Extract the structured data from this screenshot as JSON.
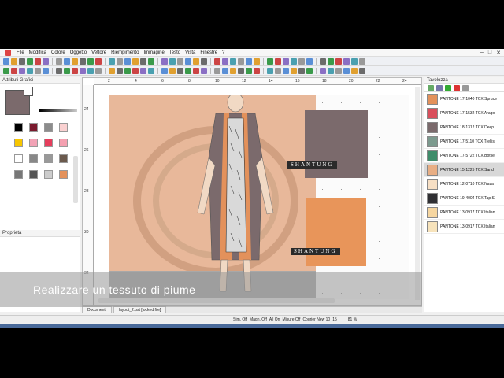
{
  "menu": [
    "File",
    "Modifica",
    "Colore",
    "Oggetto",
    "Vettore",
    "Riempimento",
    "Immagine",
    "Testo",
    "Vista",
    "Finestre",
    "?"
  ],
  "window_controls": {
    "minimize": "–",
    "maximize": "□",
    "close": "✕"
  },
  "left_panel": {
    "title": "Attributi Grafici",
    "properties_title": "Proprietà"
  },
  "palette_colors": [
    "#000000",
    "#7a1a2e",
    "#8c8c8c",
    "#fad1d1",
    "#f7c600",
    "#f2a3b6",
    "#e53e5c",
    "#f4a0b0",
    "#ffffff",
    "#888888",
    "#999999",
    "#6b5a4d",
    "#777777",
    "#555555",
    "#cccccc",
    "#e3915b"
  ],
  "canvas": {
    "ruler_top": [
      "2",
      "4",
      "6",
      "8",
      "10",
      "12",
      "14",
      "16",
      "18",
      "20",
      "22",
      "24"
    ],
    "ruler_left": [
      "24",
      "26",
      "28",
      "30",
      "32"
    ],
    "label1": "SHANTUNG",
    "label2": "SHANTUNG"
  },
  "right_panel": {
    "title": "Tavolozza",
    "colors": [
      {
        "name": "PANTONE 17-1040 TCX Spruce",
        "hex": "#e3915b"
      },
      {
        "name": "PANTONE 17-1532 TCX Arago",
        "hex": "#d94f5c"
      },
      {
        "name": "PANTONE 18-1312 TCX Deep",
        "hex": "#7b6a6c"
      },
      {
        "name": "PANTONE 17-5110 TCX Trellis",
        "hex": "#7c9a8e"
      },
      {
        "name": "PANTONE 17-5722 TCX Bottle",
        "hex": "#3f8c6a"
      },
      {
        "name": "PANTONE 15-1225 TCX Sand",
        "hex": "#e8ae84"
      },
      {
        "name": "PANTONE 12-0710 TCX Nava",
        "hex": "#f7dfc4"
      },
      {
        "name": "PANTONE 19-4004 TCX Tap S",
        "hex": "#2f2f33"
      },
      {
        "name": "PANTONE 13-0917 TCX Italian",
        "hex": "#f6d6a0"
      },
      {
        "name": "PANTONE 13-0917 TCX Italian",
        "hex": "#f7e3bb"
      }
    ]
  },
  "tabs": [
    "Documenti",
    "layout_2.pst [locked file]"
  ],
  "status": {
    "sim": "Sim. Off",
    "magn": "Magn. Off",
    "all": "All On",
    "misure": "Misure Off",
    "font": "Courier New 10",
    "size": "15",
    "zoom": "81 %"
  },
  "subtitle": "Realizzare un tessuto di piume"
}
